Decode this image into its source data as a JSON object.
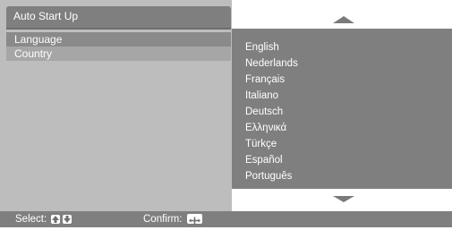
{
  "menu": {
    "title": "Auto Start Up",
    "items": [
      {
        "label": "Language"
      },
      {
        "label": "Country"
      }
    ]
  },
  "languages": [
    "English",
    "Nederlands",
    "Français",
    "Italiano",
    "Deutsch",
    "Ελληνικά",
    "Türkçe",
    "Español",
    "Português"
  ],
  "footer": {
    "select_label": "Select:",
    "confirm_label": "Confirm:"
  },
  "icons": {
    "scroll_up": "arrow-up-icon",
    "scroll_down": "arrow-down-icon",
    "select_up": "up-key-icon",
    "select_down": "down-key-icon",
    "confirm": "ok-key-icon"
  }
}
